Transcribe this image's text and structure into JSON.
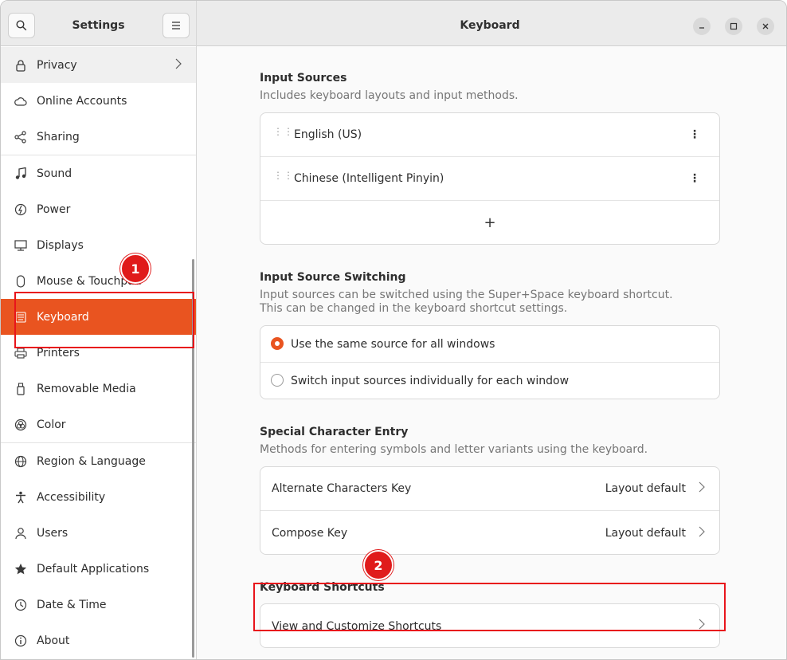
{
  "sidebar": {
    "title": "Settings",
    "items": [
      {
        "label": "Privacy",
        "icon": "lock-icon"
      },
      {
        "label": "Online Accounts",
        "icon": "cloud-icon"
      },
      {
        "label": "Sharing",
        "icon": "share-icon"
      },
      {
        "label": "Sound",
        "icon": "music-note-icon"
      },
      {
        "label": "Power",
        "icon": "power-icon"
      },
      {
        "label": "Displays",
        "icon": "display-icon"
      },
      {
        "label": "Mouse & Touchpad",
        "icon": "mouse-icon"
      },
      {
        "label": "Keyboard",
        "icon": "keyboard-icon"
      },
      {
        "label": "Printers",
        "icon": "printer-icon"
      },
      {
        "label": "Removable Media",
        "icon": "usb-icon"
      },
      {
        "label": "Color",
        "icon": "color-icon"
      },
      {
        "label": "Region & Language",
        "icon": "globe-icon"
      },
      {
        "label": "Accessibility",
        "icon": "accessibility-icon"
      },
      {
        "label": "Users",
        "icon": "users-icon"
      },
      {
        "label": "Default Applications",
        "icon": "star-icon"
      },
      {
        "label": "Date & Time",
        "icon": "clock-icon"
      },
      {
        "label": "About",
        "icon": "info-icon"
      }
    ]
  },
  "main": {
    "title": "Keyboard",
    "input_sources": {
      "title": "Input Sources",
      "description": "Includes keyboard layouts and input methods.",
      "items": [
        "English (US)",
        "Chinese (Intelligent Pinyin)"
      ],
      "add_label": "+"
    },
    "switching": {
      "title": "Input Source Switching",
      "description_1": "Input sources can be switched using the Super+Space keyboard shortcut.",
      "description_2": "This can be changed in the keyboard shortcut settings.",
      "options": [
        "Use the same source for all windows",
        "Switch input sources individually for each window"
      ],
      "selected_index": 0
    },
    "special": {
      "title": "Special Character Entry",
      "description": "Methods for entering symbols and letter variants using the keyboard.",
      "rows": [
        {
          "label": "Alternate Characters Key",
          "value": "Layout default"
        },
        {
          "label": "Compose Key",
          "value": "Layout default"
        }
      ]
    },
    "shortcuts": {
      "title": "Keyboard Shortcuts",
      "row_label": "View and Customize Shortcuts"
    }
  },
  "annotations": {
    "step1": "1",
    "step2": "2",
    "color": "#e8141b"
  },
  "colors": {
    "accent": "#e95420"
  }
}
